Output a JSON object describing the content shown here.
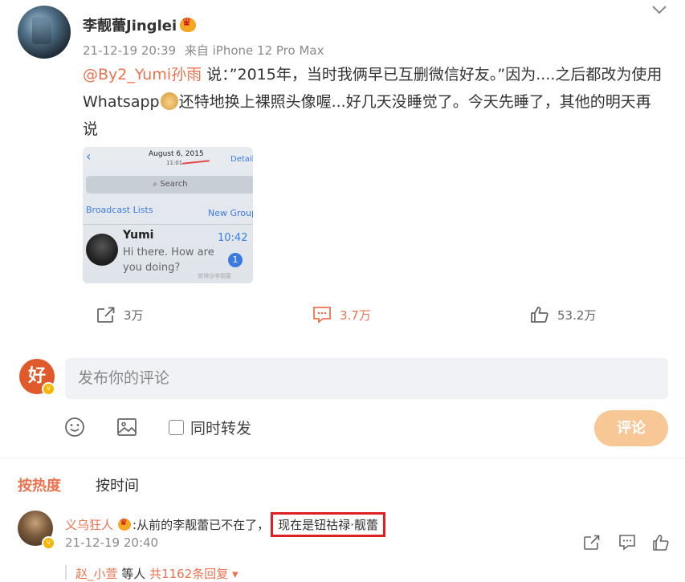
{
  "post": {
    "author": "李靓蕾Jinglei",
    "timestamp": "21-12-19 20:39",
    "source": "来自 iPhone 12 Pro Max",
    "mention": "@By2_Yumi孙雨",
    "text_part1": " 说：”2015年，当时我俩早已互删微信好友。”因为....之后都改为使用Whatsapp",
    "text_part2": "还特地换上裸照头像喔...好几天没睡觉了。今天先睡了，其他的明天再说",
    "emoji_dog": "doge-emoji",
    "emoji_wave": "👋"
  },
  "image": {
    "date": "August 6, 2015",
    "time": "11:01",
    "details": "Details",
    "search": "Search",
    "broadcast": "Broadcast Lists",
    "new_group": "New Group",
    "contact_name": "Yumi",
    "contact_time": "10:42",
    "message": "Hi there. How are you doing?",
    "badge": "1",
    "watermark": "微博@李靓蕾"
  },
  "actions": {
    "repost_count": "3万",
    "comment_count": "3.7万",
    "like_count": "53.2万"
  },
  "composer": {
    "placeholder": "发布你的评论",
    "avatar_char": "好",
    "repost_label": "同时转发",
    "submit_label": "评论"
  },
  "tabs": {
    "hot": "按热度",
    "time": "按时间"
  },
  "comment": {
    "user": "义乌狂人",
    "text_plain": ":从前的李靓蕾已不在了，",
    "text_highlight": "现在是钮祜禄·靓蕾",
    "timestamp": "21-12-19 20:40",
    "replies_users": "赵_小萱",
    "replies_suffix": " 等人 ",
    "replies_count": "共1162条回复"
  },
  "colors": {
    "accent": "#eb7350",
    "submit_bg": "#f7c896",
    "highlight_border": "#e02020"
  }
}
